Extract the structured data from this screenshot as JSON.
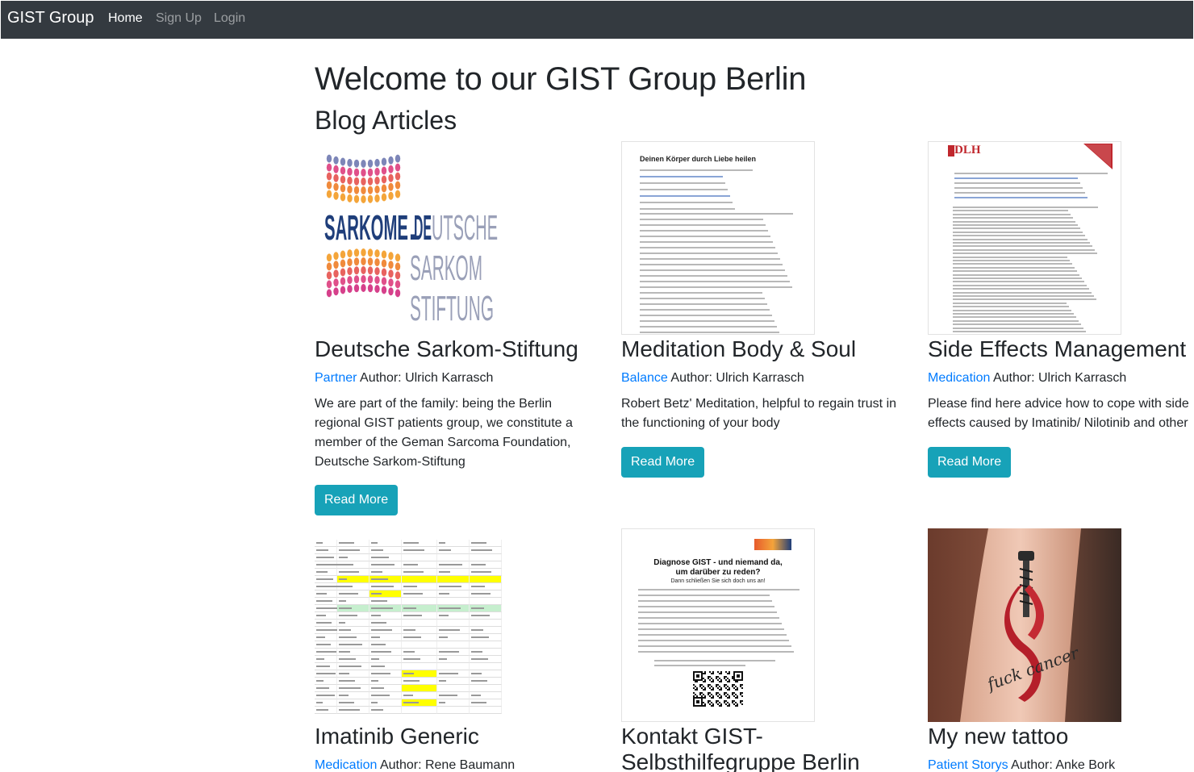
{
  "navbar": {
    "brand": "GIST Group",
    "links": [
      {
        "label": "Home",
        "active": true
      },
      {
        "label": "Sign Up",
        "active": false
      },
      {
        "label": "Login",
        "active": false
      }
    ]
  },
  "page": {
    "title": "Welcome to our GIST Group Berlin",
    "subtitle": "Blog Articles"
  },
  "colors": {
    "navbar_bg": "#343a40",
    "link_blue": "#007bff",
    "button_teal": "#17a2b8"
  },
  "articles": [
    {
      "title": "Deutsche Sarkom-Stiftung",
      "category": "Partner",
      "author": "Author: Ulrich Karrasch",
      "description": "We are part of the family: being the Berlin regional GIST patients group, we constitute a member of the Geman Sarcoma Foundation, Deutsche Sarkom-Stiftung",
      "button": "Read More",
      "logo_text_1": "SARKOME.DEUTSCHE",
      "logo_text_2": "SARKOM",
      "logo_text_3": "STIFTUNG"
    },
    {
      "title": "Meditation Body & Soul",
      "category": "Balance",
      "author": "Author: Ulrich Karrasch",
      "description": "Robert Betz' Meditation, helpful to regain trust in the functioning of your body",
      "button": "Read More",
      "doc_heading": "Deinen Körper durch Liebe heilen"
    },
    {
      "title": "Side Effects Management",
      "category": "Medication",
      "author": "Author: Ulrich Karrasch",
      "description": "Please find here advice how to cope with side effects caused by Imatinib/ Nilotinib and other",
      "button": "Read More",
      "doc_logo": "DLH"
    },
    {
      "title": "Imatinib Generic",
      "category": "Medication",
      "author": "Author: Rene Baumann"
    },
    {
      "title": "Kontakt GIST-Selbsthilfegruppe Berlin",
      "title_line_1": "Kontakt GIST-",
      "title_line_2": "Selbsthilfegruppe Berlin",
      "category": "",
      "author": "",
      "doc_heading_1": "Diagnose GIST - und niemand da,",
      "doc_heading_2": "um darüber zu reden?",
      "doc_sub": "Dann schließen Sie sich doch uns an!"
    },
    {
      "title": "My new tattoo",
      "category": "Patient Storys",
      "author": "Author: Anke Bork",
      "tattoo_text": "fuck cancer"
    }
  ]
}
